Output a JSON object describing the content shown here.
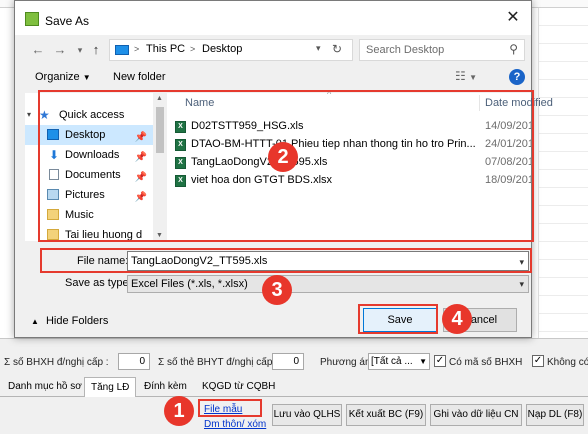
{
  "background": {
    "filters": {
      "bhxh_label": "Σ số BHXH đ/nghị cấp :",
      "bhxh_value": "0",
      "bhyt_label": "Σ số thẻ BHYT đ/nghị cấp :",
      "bhyt_value": "0",
      "phuong_an_label": "Phương án",
      "phuong_an_value": "[Tất cả ...",
      "co_ma_so_label": "Có mã số BHXH",
      "khong_co_label": "Không có"
    },
    "tabs": [
      "Danh mục hồ sơ",
      "Tăng LĐ",
      "Đính kèm",
      "KQGD từ CQBH"
    ],
    "links": {
      "file_mau": "File mẫu",
      "dm_thon_xom": "Dm thôn/ xóm"
    },
    "buttons": {
      "luu_vao": "Lưu vào QLHS",
      "ket_xuat": "Kết xuất BC (F9)",
      "ghi_vao": "Ghi vào dữ liệu CN",
      "nap_dl": "Nạp DL (F8)"
    }
  },
  "dialog": {
    "title": "Save As",
    "address": {
      "path": [
        "This PC",
        "Desktop"
      ],
      "separator": ">"
    },
    "search_placeholder": "Search Desktop",
    "toolbar": {
      "organize": "Organize",
      "new_folder": "New folder"
    },
    "nav": {
      "quick_access": "Quick access",
      "items": [
        {
          "label": "Desktop",
          "icon": "desktop-icon",
          "pinned": true,
          "selected": true
        },
        {
          "label": "Downloads",
          "icon": "download-icon",
          "pinned": true
        },
        {
          "label": "Documents",
          "icon": "documents-icon",
          "pinned": true
        },
        {
          "label": "Pictures",
          "icon": "pictures-icon",
          "pinned": true
        },
        {
          "label": "Music",
          "icon": "folder-icon",
          "pinned": false
        },
        {
          "label": "Tai lieu huong d",
          "icon": "folder-icon",
          "pinned": false
        }
      ]
    },
    "columns": {
      "name": "Name",
      "date": "Date modified"
    },
    "files": [
      {
        "name": "D02TSTT959_HSG.xls",
        "date": "14/09/2018 9:2"
      },
      {
        "name": "DTAO-BM-HTTT-01 Phieu tiep nhan thong tin ho tro Prin...",
        "date": "24/01/2018 11"
      },
      {
        "name": "TangLaoDongV2_TT595.xls",
        "date": "07/08/2018 4:5"
      },
      {
        "name": "viet hoa don GTGT BDS.xlsx",
        "date": "18/09/2018 9:"
      }
    ],
    "filename_label": "File name:",
    "filename_value": "TangLaoDongV2_TT595.xls",
    "savetype_label": "Save as type:",
    "savetype_value": "Excel Files (*.xls, *.xlsx)",
    "hide_folders": "Hide Folders",
    "save": "Save",
    "cancel": "Cancel"
  },
  "annotations": {
    "badges": [
      "1",
      "2",
      "3",
      "4"
    ],
    "color": "#e53a2e"
  },
  "colors": {
    "accent": "#0078d7",
    "excel_green": "#1f7244",
    "selected_nav": "#cce8ff"
  }
}
